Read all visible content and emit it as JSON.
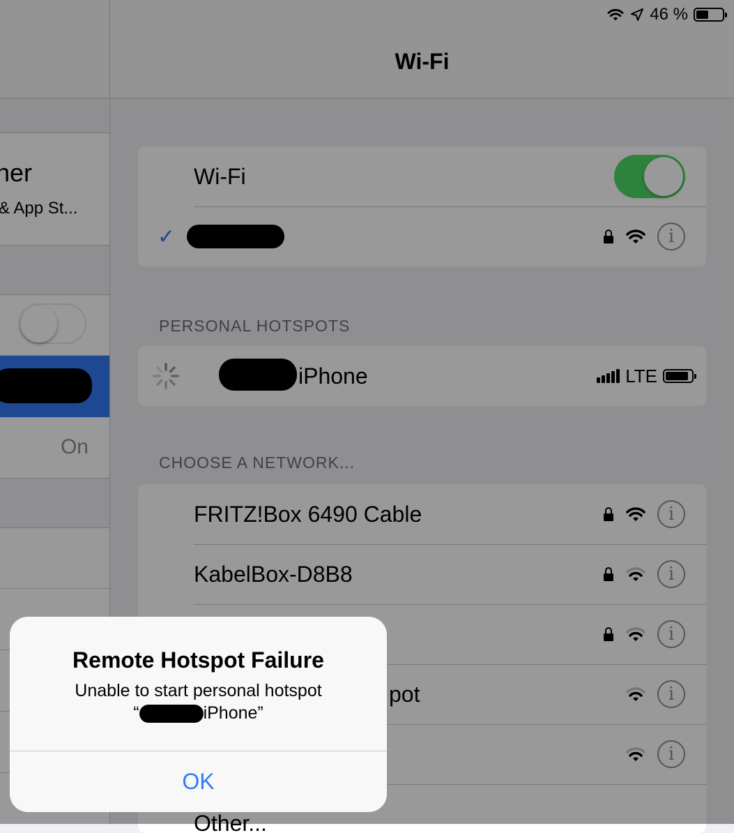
{
  "status_bar": {
    "battery_percent": "46 %",
    "battery_level": 0.46
  },
  "sidebar": {
    "profile_name_fragment": "ner",
    "profile_subtitle_fragment": "& App St...",
    "wifi_value": "On"
  },
  "nav": {
    "title": "Wi-Fi"
  },
  "wifi_group": {
    "toggle_label": "Wi-Fi",
    "toggle_on": true,
    "connected_network_name": "[redacted]"
  },
  "hotspots": {
    "header": "PERSONAL HOTSPOTS",
    "items": [
      {
        "name_suffix": "iPhone",
        "network_type": "LTE",
        "signal_bars": 4
      }
    ]
  },
  "networks": {
    "header": "CHOOSE A NETWORK...",
    "items": [
      {
        "name": "FRITZ!Box 6490 Cable",
        "secured": true
      },
      {
        "name": "KabelBox-D8B8",
        "secured": true
      },
      {
        "name": "",
        "secured": true
      },
      {
        "name": "pot",
        "secured": false
      },
      {
        "name": "",
        "secured": false
      }
    ],
    "other_label": "Other..."
  },
  "alert": {
    "title": "Remote Hotspot Failure",
    "message_line1": "Unable to start personal hotspot",
    "message_line2_open": "“",
    "message_line2_suffix": "iPhone”",
    "ok_label": "OK"
  },
  "colors": {
    "accent": "#3478f6",
    "toggle_on": "#4cd964",
    "background": "#efeff4"
  }
}
